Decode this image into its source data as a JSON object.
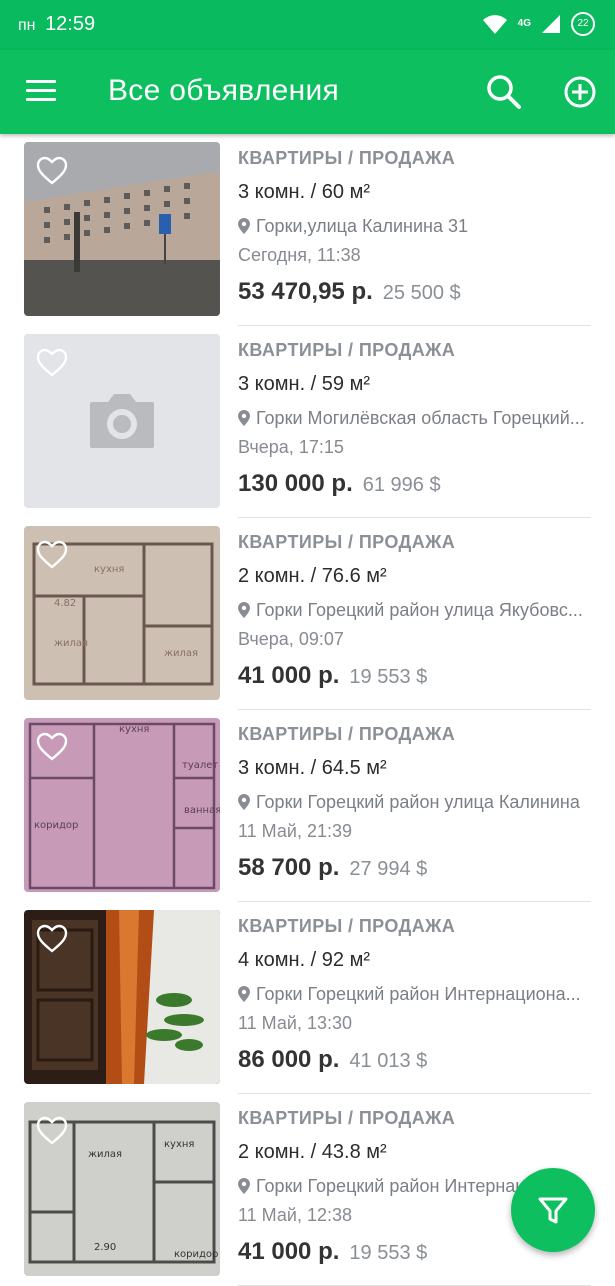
{
  "status_bar": {
    "day": "пн",
    "time": "12:59",
    "network": "4G",
    "battery": "22"
  },
  "app_bar": {
    "title": "Все объявления",
    "menu_icon": "hamburger-menu-icon",
    "search_icon": "search-icon",
    "add_icon": "add-circle-icon"
  },
  "listings": [
    {
      "category": "КВАРТИРЫ / ПРОДАЖА",
      "rooms": "3 комн. / 60 м²",
      "address": "Горки,улица Калинина 31",
      "date": "Сегодня, 11:38",
      "price": "53 470,95 р.",
      "price_usd": "25 500 $",
      "photo": "building-photo"
    },
    {
      "category": "КВАРТИРЫ / ПРОДАЖА",
      "rooms": "3 комн. / 59 м²",
      "address": "Горки Могилёвская область Горецкий...",
      "date": "Вчера, 17:15",
      "price": "130 000 р.",
      "price_usd": "61 996 $",
      "photo": "camera-placeholder-icon"
    },
    {
      "category": "КВАРТИРЫ / ПРОДАЖА",
      "rooms": "2 комн. / 76.6 м²",
      "address": "Горки Горецкий район улица Якубовс...",
      "date": "Вчера, 09:07",
      "price": "41 000 р.",
      "price_usd": "19 553 $",
      "photo": "floor-plan-photo"
    },
    {
      "category": "КВАРТИРЫ / ПРОДАЖА",
      "rooms": "3 комн. / 64.5 м²",
      "address": "Горки Горецкий район улица Калинина",
      "date": "11 Май, 21:39",
      "price": "58 700 р.",
      "price_usd": "27 994 $",
      "photo": "pink-floor-plan-photo"
    },
    {
      "category": "КВАРТИРЫ / ПРОДАЖА",
      "rooms": "4 комн. / 92 м²",
      "address": "Горки Горецкий район Интернациона...",
      "date": "11 Май, 13:30",
      "price": "86 000 р.",
      "price_usd": "41 013 $",
      "photo": "interior-photo"
    },
    {
      "category": "КВАРТИРЫ / ПРОДАЖА",
      "rooms": "2 комн. / 43.8 м²",
      "address": "Горки Горецкий район Интернац",
      "date": "11 Май, 12:38",
      "price": "41 000 р.",
      "price_usd": "19 553 $",
      "photo": "floor-plan-photo"
    }
  ],
  "fab": {
    "icon": "filter-icon"
  },
  "colors": {
    "primary": "#0dbf5f",
    "status_bar": "#0aba5e"
  }
}
